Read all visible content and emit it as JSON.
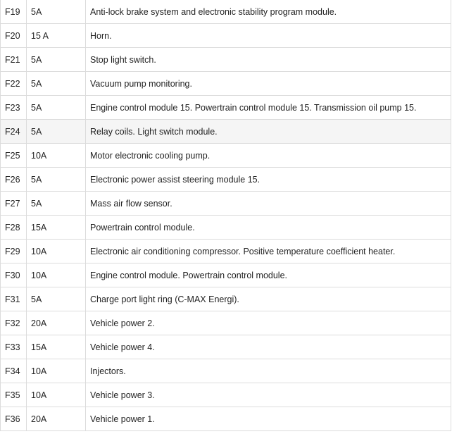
{
  "fuses": [
    {
      "id": "F19",
      "amp": "5A",
      "desc": "Anti-lock brake system and electronic stability program module."
    },
    {
      "id": "F20",
      "amp": "15 A",
      "desc": "Horn."
    },
    {
      "id": "F21",
      "amp": "5A",
      "desc": "Stop light switch."
    },
    {
      "id": "F22",
      "amp": "5A",
      "desc": "Vacuum pump monitoring."
    },
    {
      "id": "F23",
      "amp": "5A",
      "desc": "Engine control module 15. Powertrain control module 15. Transmission oil pump 15."
    },
    {
      "id": "F24",
      "amp": "5A",
      "desc": "Relay coils. Light switch module."
    },
    {
      "id": "F25",
      "amp": "10A",
      "desc": "Motor electronic cooling pump."
    },
    {
      "id": "F26",
      "amp": "5A",
      "desc": "Electronic power assist steering module 15."
    },
    {
      "id": "F27",
      "amp": "5A",
      "desc": "Mass air flow sensor."
    },
    {
      "id": "F28",
      "amp": "15A",
      "desc": "Powertrain control module."
    },
    {
      "id": "F29",
      "amp": "10A",
      "desc": "Electronic air conditioning compressor. Positive temperature coefficient heater."
    },
    {
      "id": "F30",
      "amp": "10A",
      "desc": "Engine control module. Powertrain control module."
    },
    {
      "id": "F31",
      "amp": "5A",
      "desc": "Charge port light ring (C-MAX Energi)."
    },
    {
      "id": "F32",
      "amp": "20A",
      "desc": "Vehicle power 2."
    },
    {
      "id": "F33",
      "amp": "15A",
      "desc": "Vehicle power 4."
    },
    {
      "id": "F34",
      "amp": "10A",
      "desc": "Injectors."
    },
    {
      "id": "F35",
      "amp": "10A",
      "desc": "Vehicle power 3."
    },
    {
      "id": "F36",
      "amp": "20A",
      "desc": "Vehicle power 1."
    }
  ],
  "highlight_color": "#f5f5f5",
  "border_color": "#dcdcdc"
}
